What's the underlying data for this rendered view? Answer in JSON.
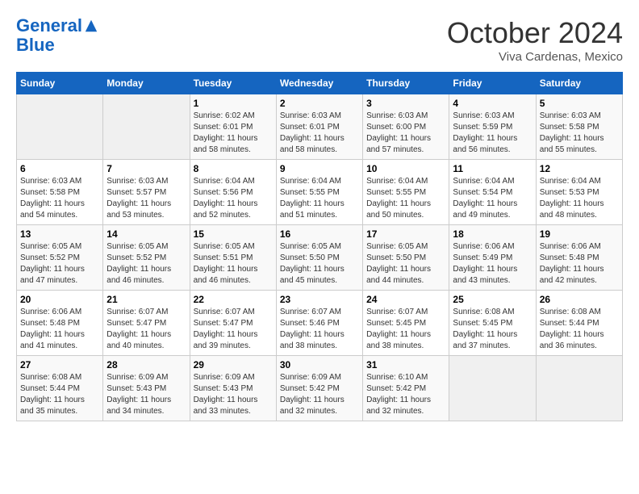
{
  "header": {
    "logo_line1": "General",
    "logo_line2": "Blue",
    "month_title": "October 2024",
    "subtitle": "Viva Cardenas, Mexico"
  },
  "days_of_week": [
    "Sunday",
    "Monday",
    "Tuesday",
    "Wednesday",
    "Thursday",
    "Friday",
    "Saturday"
  ],
  "weeks": [
    [
      {
        "day": "",
        "info": ""
      },
      {
        "day": "",
        "info": ""
      },
      {
        "day": "1",
        "info": "Sunrise: 6:02 AM\nSunset: 6:01 PM\nDaylight: 11 hours and 58 minutes."
      },
      {
        "day": "2",
        "info": "Sunrise: 6:03 AM\nSunset: 6:01 PM\nDaylight: 11 hours and 58 minutes."
      },
      {
        "day": "3",
        "info": "Sunrise: 6:03 AM\nSunset: 6:00 PM\nDaylight: 11 hours and 57 minutes."
      },
      {
        "day": "4",
        "info": "Sunrise: 6:03 AM\nSunset: 5:59 PM\nDaylight: 11 hours and 56 minutes."
      },
      {
        "day": "5",
        "info": "Sunrise: 6:03 AM\nSunset: 5:58 PM\nDaylight: 11 hours and 55 minutes."
      }
    ],
    [
      {
        "day": "6",
        "info": "Sunrise: 6:03 AM\nSunset: 5:58 PM\nDaylight: 11 hours and 54 minutes."
      },
      {
        "day": "7",
        "info": "Sunrise: 6:03 AM\nSunset: 5:57 PM\nDaylight: 11 hours and 53 minutes."
      },
      {
        "day": "8",
        "info": "Sunrise: 6:04 AM\nSunset: 5:56 PM\nDaylight: 11 hours and 52 minutes."
      },
      {
        "day": "9",
        "info": "Sunrise: 6:04 AM\nSunset: 5:55 PM\nDaylight: 11 hours and 51 minutes."
      },
      {
        "day": "10",
        "info": "Sunrise: 6:04 AM\nSunset: 5:55 PM\nDaylight: 11 hours and 50 minutes."
      },
      {
        "day": "11",
        "info": "Sunrise: 6:04 AM\nSunset: 5:54 PM\nDaylight: 11 hours and 49 minutes."
      },
      {
        "day": "12",
        "info": "Sunrise: 6:04 AM\nSunset: 5:53 PM\nDaylight: 11 hours and 48 minutes."
      }
    ],
    [
      {
        "day": "13",
        "info": "Sunrise: 6:05 AM\nSunset: 5:52 PM\nDaylight: 11 hours and 47 minutes."
      },
      {
        "day": "14",
        "info": "Sunrise: 6:05 AM\nSunset: 5:52 PM\nDaylight: 11 hours and 46 minutes."
      },
      {
        "day": "15",
        "info": "Sunrise: 6:05 AM\nSunset: 5:51 PM\nDaylight: 11 hours and 46 minutes."
      },
      {
        "day": "16",
        "info": "Sunrise: 6:05 AM\nSunset: 5:50 PM\nDaylight: 11 hours and 45 minutes."
      },
      {
        "day": "17",
        "info": "Sunrise: 6:05 AM\nSunset: 5:50 PM\nDaylight: 11 hours and 44 minutes."
      },
      {
        "day": "18",
        "info": "Sunrise: 6:06 AM\nSunset: 5:49 PM\nDaylight: 11 hours and 43 minutes."
      },
      {
        "day": "19",
        "info": "Sunrise: 6:06 AM\nSunset: 5:48 PM\nDaylight: 11 hours and 42 minutes."
      }
    ],
    [
      {
        "day": "20",
        "info": "Sunrise: 6:06 AM\nSunset: 5:48 PM\nDaylight: 11 hours and 41 minutes."
      },
      {
        "day": "21",
        "info": "Sunrise: 6:07 AM\nSunset: 5:47 PM\nDaylight: 11 hours and 40 minutes."
      },
      {
        "day": "22",
        "info": "Sunrise: 6:07 AM\nSunset: 5:47 PM\nDaylight: 11 hours and 39 minutes."
      },
      {
        "day": "23",
        "info": "Sunrise: 6:07 AM\nSunset: 5:46 PM\nDaylight: 11 hours and 38 minutes."
      },
      {
        "day": "24",
        "info": "Sunrise: 6:07 AM\nSunset: 5:45 PM\nDaylight: 11 hours and 38 minutes."
      },
      {
        "day": "25",
        "info": "Sunrise: 6:08 AM\nSunset: 5:45 PM\nDaylight: 11 hours and 37 minutes."
      },
      {
        "day": "26",
        "info": "Sunrise: 6:08 AM\nSunset: 5:44 PM\nDaylight: 11 hours and 36 minutes."
      }
    ],
    [
      {
        "day": "27",
        "info": "Sunrise: 6:08 AM\nSunset: 5:44 PM\nDaylight: 11 hours and 35 minutes."
      },
      {
        "day": "28",
        "info": "Sunrise: 6:09 AM\nSunset: 5:43 PM\nDaylight: 11 hours and 34 minutes."
      },
      {
        "day": "29",
        "info": "Sunrise: 6:09 AM\nSunset: 5:43 PM\nDaylight: 11 hours and 33 minutes."
      },
      {
        "day": "30",
        "info": "Sunrise: 6:09 AM\nSunset: 5:42 PM\nDaylight: 11 hours and 32 minutes."
      },
      {
        "day": "31",
        "info": "Sunrise: 6:10 AM\nSunset: 5:42 PM\nDaylight: 11 hours and 32 minutes."
      },
      {
        "day": "",
        "info": ""
      },
      {
        "day": "",
        "info": ""
      }
    ]
  ]
}
